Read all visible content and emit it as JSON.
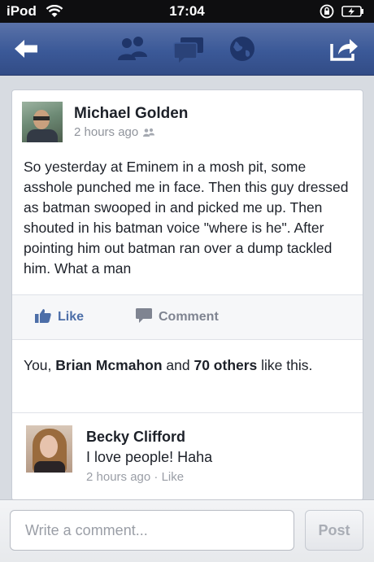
{
  "status_bar": {
    "carrier": "iPod",
    "time": "17:04",
    "icons": [
      "wifi-icon",
      "rotation-lock-icon",
      "battery-charging-icon"
    ]
  },
  "nav_bar": {
    "icons": [
      "back-arrow-icon",
      "friends-icon",
      "messages-icon",
      "globe-icon",
      "share-icon"
    ],
    "background": "#3b5998"
  },
  "post": {
    "author": "Michael Golden",
    "time": "2 hours ago",
    "text": "So yesterday at Eminem in a mosh pit, some asshole punched me in face. Then this guy dressed as batman swooped in and picked me up. Then shouted in his batman voice \"where is he\". After pointing him out batman ran over a dump tackled him. What a man",
    "like_label": "Like",
    "comment_label": "Comment"
  },
  "likes": {
    "prefix": "You, ",
    "name": "Brian Mcmahon",
    "middle": " and ",
    "others": "70 others",
    "suffix": " like this."
  },
  "comment": {
    "author": "Becky Clifford",
    "text": "I love people! Haha",
    "time": "2 hours ago",
    "separator": " · ",
    "like_label": "Like"
  },
  "composer": {
    "placeholder": "Write a comment...",
    "post_label": "Post"
  },
  "colors": {
    "brand": "#3b5998",
    "link": "#4c6ea8",
    "muted": "#90949c",
    "background": "#d7dbe1"
  }
}
